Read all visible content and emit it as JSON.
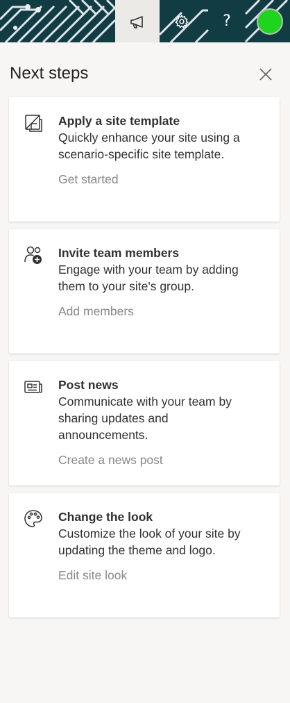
{
  "topbar": {
    "icons": {
      "megaphone": "megaphone-icon",
      "settings": "gear-icon",
      "help": "?",
      "avatar": "user-avatar"
    },
    "colors": {
      "background": "#123c44",
      "megaphone_active_bg": "#eceae7",
      "avatar": "#1fd41f"
    }
  },
  "panel": {
    "title": "Next steps",
    "close_icon": "close-icon"
  },
  "cards": [
    {
      "icon": "template-icon",
      "title": "Apply a site template",
      "description": "Quickly enhance your site using a scenario-specific site template.",
      "link": "Get started"
    },
    {
      "icon": "add-people-icon",
      "title": "Invite team members",
      "description": "Engage with your team by adding them to your site's group.",
      "link": "Add members"
    },
    {
      "icon": "news-icon",
      "title": "Post news",
      "description": "Communicate with your team by sharing updates and announcements.",
      "link": "Create a news post"
    },
    {
      "icon": "palette-icon",
      "title": "Change the look",
      "description": "Customize the look of your site by updating the theme and logo.",
      "link": "Edit site look"
    }
  ]
}
